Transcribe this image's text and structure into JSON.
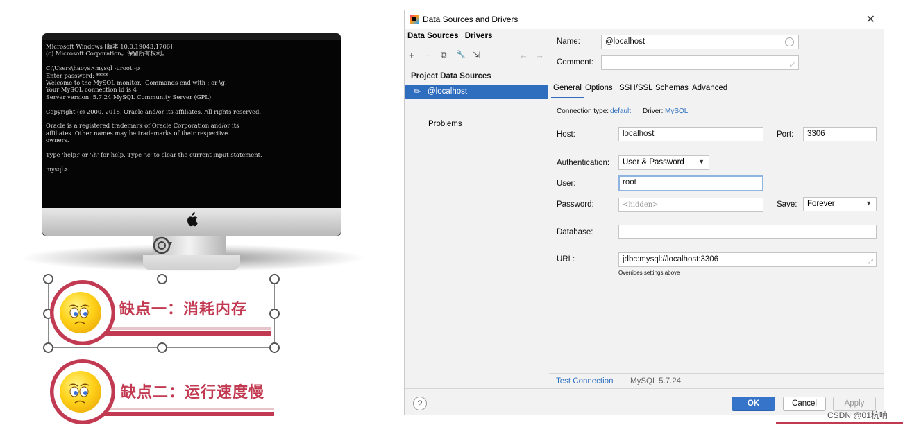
{
  "terminal": {
    "lines": [
      "Microsoft Windows [版本 10.0.19043.1706]",
      "(c) Microsoft Corporation。保留所有权利。",
      "",
      "C:\\Users\\haoys>mysql -uroot -p",
      "Enter password: ****",
      "Welcome to the MySQL monitor.  Commands end with ; or \\g.",
      "Your MySQL connection id is 4",
      "Server version: 5.7.24 MySQL Community Server (GPL)",
      "",
      "Copyright (c) 2000, 2018, Oracle and/or its affiliates. All rights reserved.",
      "",
      "Oracle is a registered trademark of Oracle Corporation and/or its",
      "affiliates. Other names may be trademarks of their respective",
      "owners.",
      "",
      "Type 'help;' or '\\h' for help. Type '\\c' to clear the current input statement.",
      "",
      "mysql>"
    ]
  },
  "drawbacks": {
    "first": "缺点一：消耗内存",
    "second": "缺点二：运行速度慢"
  },
  "dialog": {
    "title": "Data Sources and Drivers",
    "close_icon": "✕",
    "left": {
      "tab_data_sources": "Data Sources",
      "tab_drivers": "Drivers",
      "toolbar": {
        "add": "+",
        "remove": "−",
        "copy": "⧉",
        "properties": "🔧",
        "import": "⇲",
        "back": "←",
        "forward": "→"
      },
      "section_title": "Project Data Sources",
      "selected_item": "@localhost",
      "problems": "Problems"
    },
    "right": {
      "name_label": "Name:",
      "name_value": "@localhost",
      "comment_label": "Comment:",
      "comment_value": "",
      "tabs": [
        "General",
        "Options",
        "SSH/SSL",
        "Schemas",
        "Advanced"
      ],
      "connection_type_label": "Connection type:",
      "connection_type_value": "default",
      "driver_label": "Driver:",
      "driver_value": "MySQL",
      "host_label": "Host:",
      "host_value": "localhost",
      "port_label": "Port:",
      "port_value": "3306",
      "auth_label": "Authentication:",
      "auth_value": "User & Password",
      "user_label": "User:",
      "user_value": "root",
      "password_label": "Password:",
      "password_value": "<hidden>",
      "save_label": "Save:",
      "save_value": "Forever",
      "database_label": "Database:",
      "database_value": "",
      "url_label": "URL:",
      "url_value": "jdbc:mysql://localhost:3306",
      "url_note": "Overrides settings above",
      "test_connection": "Test Connection",
      "server_version": "MySQL 5.7.24"
    },
    "buttons": {
      "help": "?",
      "ok": "OK",
      "cancel": "Cancel",
      "apply": "Apply"
    }
  },
  "watermark": "CSDN @01杭呐",
  "colors": {
    "accent": "#2f6dbf",
    "drawback_red": "#c23a52",
    "ok_button": "#3574c9"
  }
}
